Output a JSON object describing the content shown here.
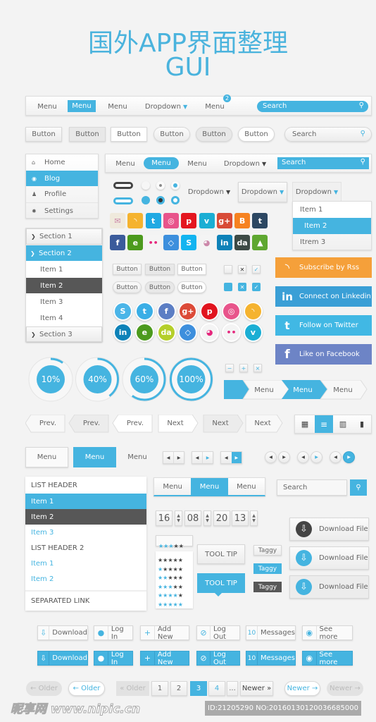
{
  "title": {
    "line1": "国外APP界面整理",
    "line2": "GUI"
  },
  "colors": {
    "accent": "#45b4e0",
    "dark": "#575757",
    "rss": "#f5a03a",
    "linkedin": "#3a9fd6",
    "twitter": "#41b8e4",
    "facebook": "#6d84c6"
  },
  "nav1": {
    "items": [
      "Menu",
      "Menu",
      "Menu",
      "Dropdown",
      "Menu"
    ],
    "badge": "2",
    "search": "Search"
  },
  "buttons_row": {
    "labels": [
      "Button",
      "Button",
      "Button",
      "Button",
      "Button",
      "Button"
    ],
    "search": "Search"
  },
  "sidebar": {
    "items": [
      {
        "label": "Home",
        "icon": "home-icon"
      },
      {
        "label": "Blog",
        "icon": "blog-icon"
      },
      {
        "label": "Profile",
        "icon": "user-icon"
      },
      {
        "label": "Settings",
        "icon": "gear-icon"
      }
    ]
  },
  "nav2": {
    "items": [
      "Menu",
      "Menu",
      "Menu",
      "Dropdown"
    ],
    "search": "Search"
  },
  "dropdowns": {
    "plain": "Dropdown",
    "button": "Dropdown",
    "open": "Dropdown",
    "menu": [
      "Item 1",
      "Item 2",
      "Itrem 3"
    ]
  },
  "social_squares": [
    {
      "name": "mail",
      "glyph": "✉",
      "color": "#efe9dc"
    },
    {
      "name": "rss",
      "glyph": "◝",
      "color": "#f5b32f"
    },
    {
      "name": "twitter",
      "glyph": "t",
      "color": "#1fa9e3"
    },
    {
      "name": "dribbble",
      "glyph": "◎",
      "color": "#e8548b"
    },
    {
      "name": "pinterest",
      "glyph": "p",
      "color": "#e4161f"
    },
    {
      "name": "vimeo",
      "glyph": "v",
      "color": "#1aaed4"
    },
    {
      "name": "google-plus",
      "glyph": "g+",
      "color": "#d84b37"
    },
    {
      "name": "blogger",
      "glyph": "B",
      "color": "#f68220"
    },
    {
      "name": "tumblr",
      "glyph": "t",
      "color": "#2c4762"
    },
    {
      "name": "facebook",
      "glyph": "f",
      "color": "#3b5b9b"
    },
    {
      "name": "evernote",
      "glyph": "e",
      "color": "#4c9a1d"
    },
    {
      "name": "flickr",
      "glyph": "••",
      "color": "#f4f4f4"
    },
    {
      "name": "dropbox",
      "glyph": "◇",
      "color": "#3d8fdd"
    },
    {
      "name": "skype",
      "glyph": "S",
      "color": "#13b4f0"
    },
    {
      "name": "picasa",
      "glyph": "◕",
      "color": "#f4f4f4"
    },
    {
      "name": "linkedin",
      "glyph": "in",
      "color": "#0e82b8"
    },
    {
      "name": "deviantart",
      "glyph": "da",
      "color": "#3d4a45"
    },
    {
      "name": "treehouse",
      "glyph": "▲",
      "color": "#5ea730"
    }
  ],
  "accordion": {
    "sections": [
      "Section 1",
      "Section 2",
      "Section 3"
    ],
    "items": [
      "Item 1",
      "Item 2",
      "Item 3",
      "Item 4"
    ]
  },
  "small_buttons": [
    "Button",
    "Button",
    "Button",
    "Button",
    "Button",
    "Button"
  ],
  "social_circles": [
    {
      "name": "skype",
      "glyph": "S",
      "color": "#4bb5e8"
    },
    {
      "name": "twitter",
      "glyph": "t",
      "color": "#3aaee6"
    },
    {
      "name": "facebook",
      "glyph": "f",
      "color": "#5c7ec4"
    },
    {
      "name": "google-plus",
      "glyph": "g+",
      "color": "#dc4a38"
    },
    {
      "name": "pinterest",
      "glyph": "p",
      "color": "#e1141e"
    },
    {
      "name": "dribbble",
      "glyph": "◎",
      "color": "#e8548b"
    },
    {
      "name": "rss",
      "glyph": "◝",
      "color": "#f5b32f"
    },
    {
      "name": "linkedin",
      "glyph": "in",
      "color": "#0e82b8"
    },
    {
      "name": "evernote",
      "glyph": "e",
      "color": "#4c9a1d"
    },
    {
      "name": "deviantart",
      "glyph": "da",
      "color": "#b5cf2a"
    },
    {
      "name": "dropbox",
      "glyph": "◇",
      "color": "#3d8fdd"
    },
    {
      "name": "picasa",
      "glyph": "◕",
      "color": "#f4f4f4"
    },
    {
      "name": "flickr",
      "glyph": "••",
      "color": "#f4f4f4"
    },
    {
      "name": "vimeo",
      "glyph": "v",
      "color": "#1aaed4"
    }
  ],
  "social_buttons": [
    {
      "label": "Subscribe by Rss",
      "icon": "rss-icon",
      "glyph": "◝"
    },
    {
      "label": "Connect on Linkedin",
      "icon": "linkedin-icon",
      "glyph": "in"
    },
    {
      "label": "Follow on Twitter",
      "icon": "twitter-icon",
      "glyph": "t"
    },
    {
      "label": "Like on Facebook",
      "icon": "facebook-icon",
      "glyph": "f"
    }
  ],
  "progress": [
    {
      "label": "10%",
      "value": 10
    },
    {
      "label": "40%",
      "value": 40
    },
    {
      "label": "60%",
      "value": 60
    },
    {
      "label": "100%",
      "value": 100
    }
  ],
  "mini_buttons": [
    "−",
    "+",
    "×"
  ],
  "breadcrumb": [
    "Menu",
    "Menu",
    "Menu"
  ],
  "prevnext": [
    "Prev.",
    "Prev.",
    "Prev.",
    "Next",
    "Next",
    "Next"
  ],
  "menu_row": [
    "Menu",
    "Menu",
    "Menu"
  ],
  "list": {
    "header1": "LIST HEADER",
    "items1": [
      "Item 1",
      "Item 2",
      "Item 3"
    ],
    "header2": "LIST HEADER 2",
    "items2": [
      "Item 1",
      "Item 2"
    ],
    "separated": "SEPARATED LINK"
  },
  "segmented": [
    "Menu",
    "Menu",
    "Menu"
  ],
  "search3": "Search",
  "time": [
    "16",
    "08",
    "20",
    "13"
  ],
  "rating": {
    "value": 3,
    "max": 5,
    "grid": [
      0,
      1,
      2,
      3,
      4,
      5
    ]
  },
  "tooltips": [
    "TOOL TIP",
    "TOOL TIP"
  ],
  "tags": [
    "Taggy",
    "Taggy",
    "Taggy"
  ],
  "download_file": [
    "Download File",
    "Download File",
    "Download File"
  ],
  "icon_buttons": [
    {
      "label": "Download",
      "icon": "download-icon",
      "glyph": "⇩"
    },
    {
      "label": "Log In",
      "icon": "user-icon",
      "glyph": "●"
    },
    {
      "label": "Add New",
      "icon": "plus-icon",
      "glyph": "+"
    },
    {
      "label": "Log Out",
      "icon": "logout-icon",
      "glyph": "⊘"
    },
    {
      "label": "Messages",
      "icon": "count",
      "glyph": "10"
    },
    {
      "label": "See more",
      "icon": "eye-icon",
      "glyph": "◉"
    }
  ],
  "pagination": {
    "older_disabled": "← Older",
    "older": "← Older",
    "older_box": "« Older",
    "pages": [
      "1",
      "2",
      "3",
      "4",
      "..."
    ],
    "current": "3",
    "newer_box": "Newer »",
    "newer": "Newer →",
    "newer_disabled": "Newer →"
  },
  "watermark": {
    "logo": "昵享网 www.nipic.cn",
    "id": "ID:21205290 NO:20160130120036685000"
  }
}
